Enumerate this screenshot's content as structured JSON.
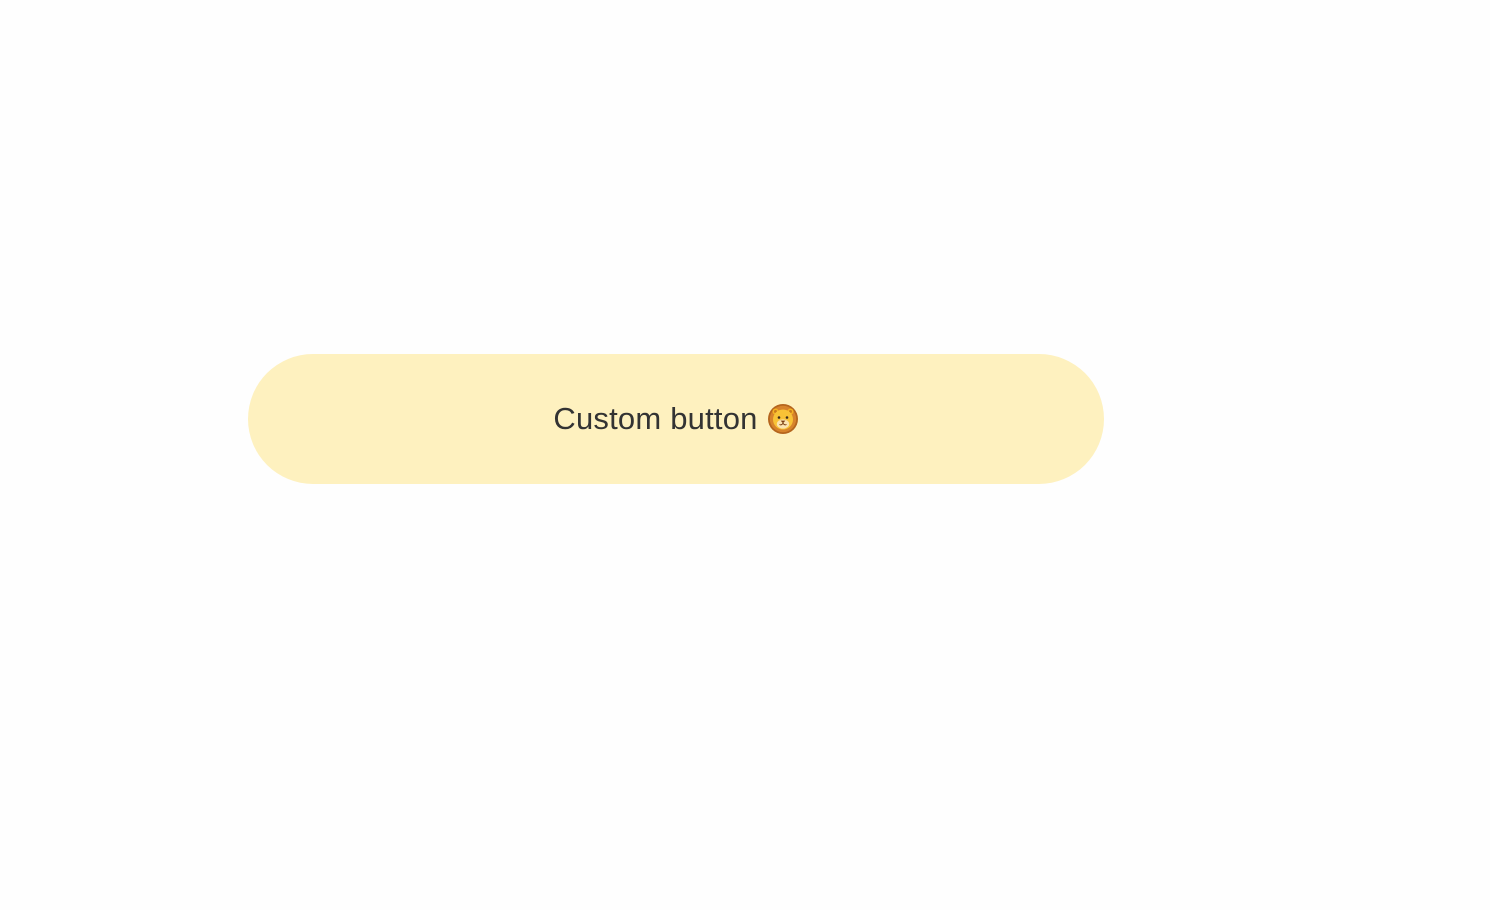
{
  "button": {
    "label": "Custom button",
    "icon": "lion-face-icon",
    "background_color": "#fef1bf",
    "text_color": "#333333"
  },
  "page": {
    "background_color": "#fefefe"
  }
}
